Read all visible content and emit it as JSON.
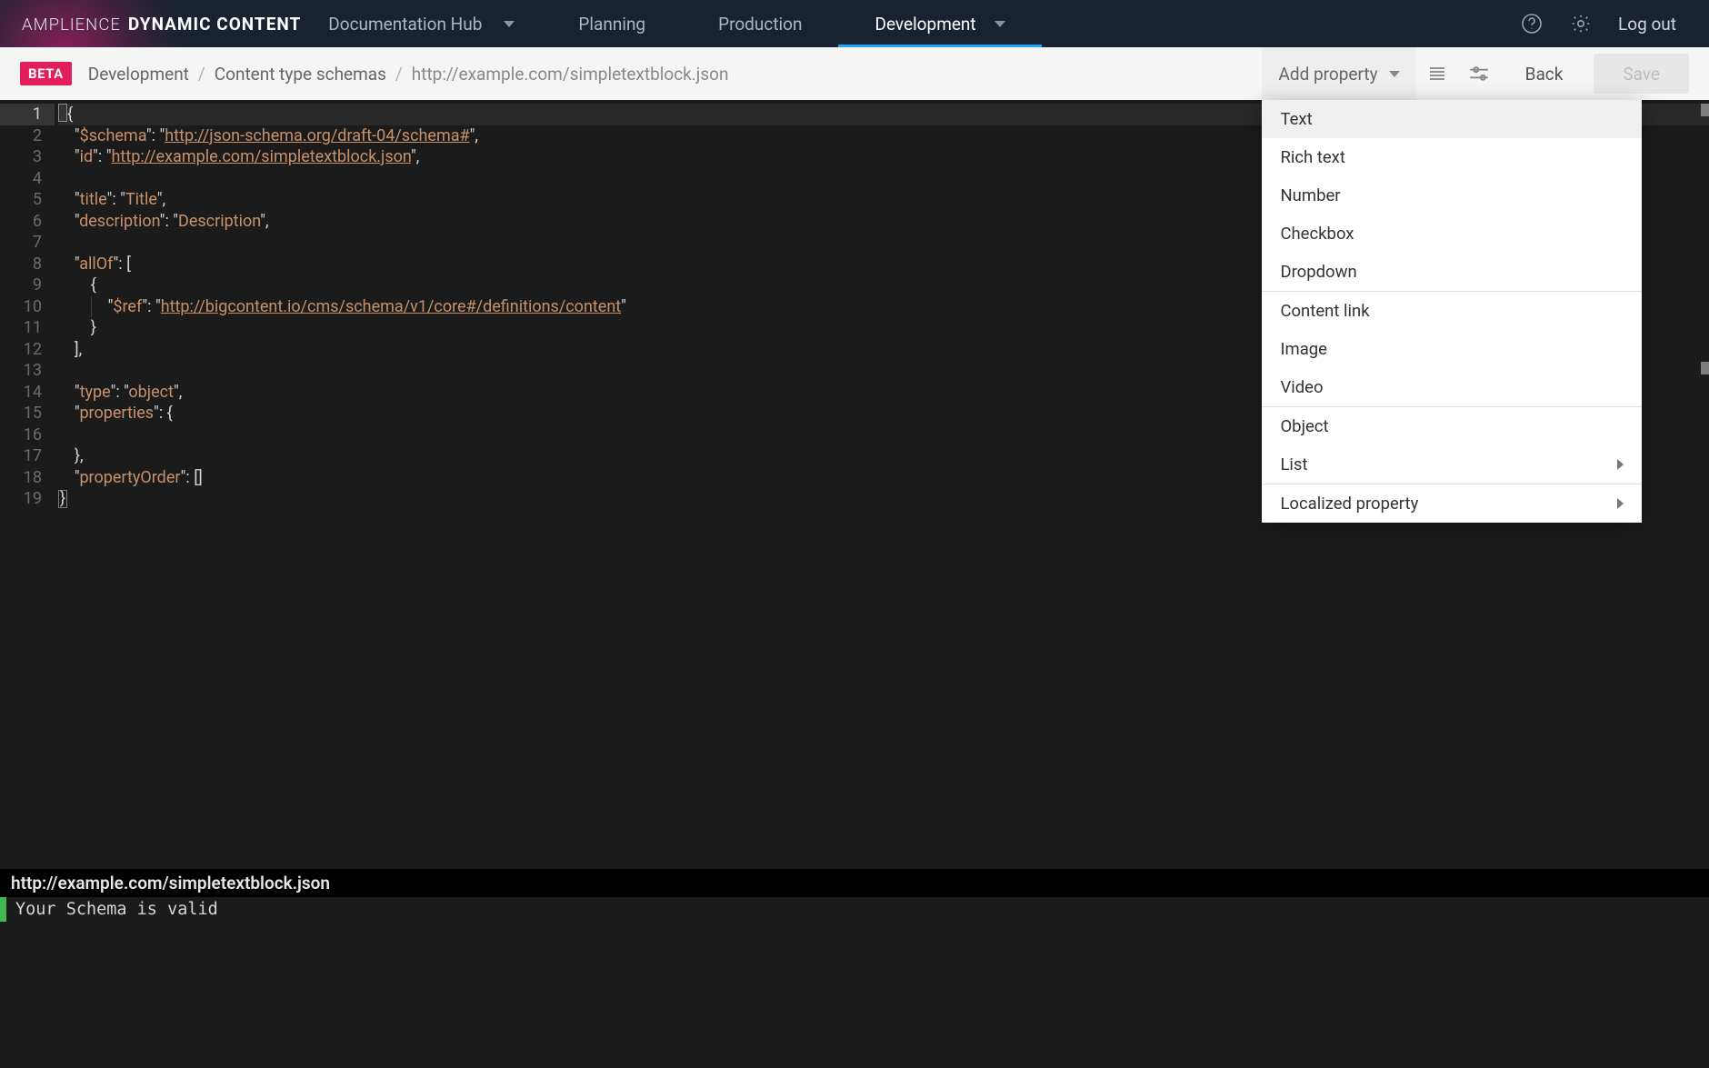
{
  "brand": {
    "a": "AMPLIENCE",
    "b": "DYNAMIC CONTENT"
  },
  "hub": {
    "label": "Documentation Hub"
  },
  "nav": {
    "planning": "Planning",
    "production": "Production",
    "development": "Development"
  },
  "topright": {
    "logout": "Log out"
  },
  "subbar": {
    "beta": "BETA",
    "crumb1": "Development",
    "crumb2": "Content type schemas",
    "crumb3": "http://example.com/simpletextblock.json",
    "addprop": "Add property",
    "back": "Back",
    "save": "Save"
  },
  "dropdown": {
    "items": [
      {
        "label": "Text",
        "highlight": true
      },
      {
        "label": "Rich text"
      },
      {
        "label": "Number"
      },
      {
        "label": "Checkbox"
      },
      {
        "label": "Dropdown"
      },
      {
        "sep": true
      },
      {
        "label": "Content link"
      },
      {
        "label": "Image"
      },
      {
        "label": "Video"
      },
      {
        "sep": true
      },
      {
        "label": "Object"
      },
      {
        "label": "List",
        "submenu": true
      },
      {
        "sep": true
      },
      {
        "label": "Localized property",
        "submenu": true
      }
    ]
  },
  "code": {
    "lines": [
      "{",
      "    \"$schema\": \"http://json-schema.org/draft-04/schema#\",",
      "    \"id\": \"http://example.com/simpletextblock.json\",",
      "",
      "    \"title\": \"Title\",",
      "    \"description\": \"Description\",",
      "",
      "    \"allOf\": [",
      "        {",
      "            \"$ref\": \"http://bigcontent.io/cms/schema/v1/core#/definitions/content\"",
      "        }",
      "    ],",
      "",
      "    \"type\": \"object\",",
      "    \"properties\": {",
      "",
      "    },",
      "    \"propertyOrder\": []",
      "}"
    ]
  },
  "console": {
    "title": "http://example.com/simpletextblock.json",
    "message": "Your Schema is valid"
  }
}
